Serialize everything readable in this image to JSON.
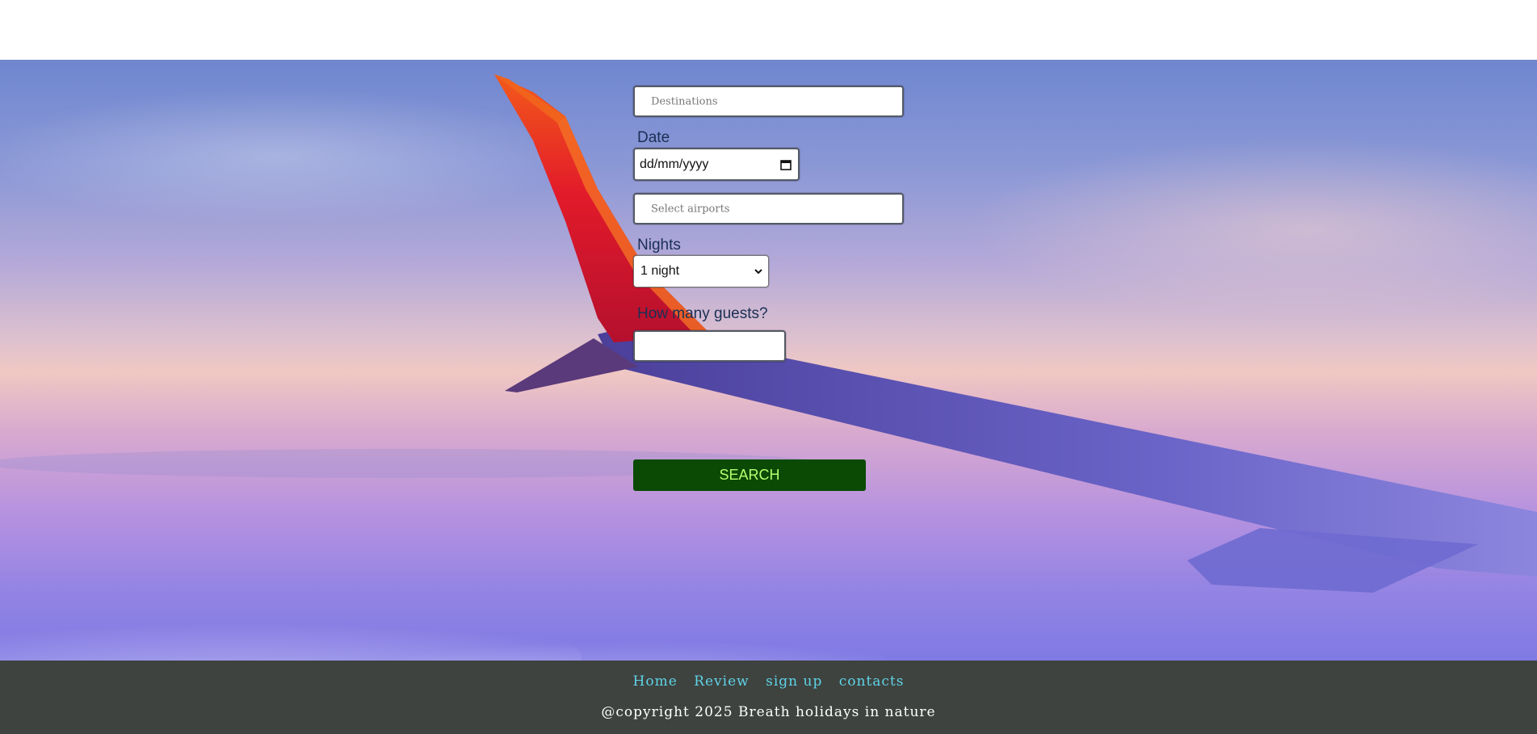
{
  "form": {
    "destinations_placeholder": "Destinations",
    "date_label": "Date",
    "date_placeholder": "dd/mm/yyyy",
    "airports_placeholder": "Select airports",
    "nights_label": "Nights",
    "nights_selected": "1 night",
    "guests_label": "How many guests?",
    "guests_value": "",
    "search_label": "SEARCH"
  },
  "footer": {
    "nav": [
      "Home",
      "Review",
      "sign up",
      "contacts"
    ],
    "copyright": "@copyright 2025 Breath holidays in nature"
  },
  "icons": {
    "date": "calendar-icon",
    "select": "chevron-down-icon"
  },
  "colors": {
    "search_bg": "#0a4a05",
    "search_text": "#b6ff6e",
    "footer_bg": "#3e433f",
    "footer_link": "#5fd3e8",
    "label_text": "#1a2f55"
  }
}
